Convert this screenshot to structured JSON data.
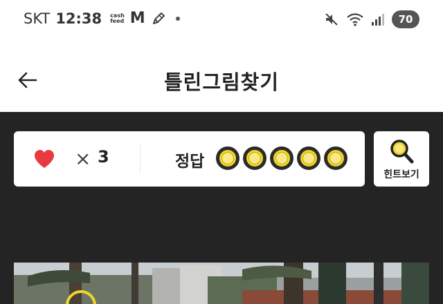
{
  "status_bar": {
    "carrier": "SKT",
    "time": "12:38",
    "cashfeed_top": "cash",
    "cashfeed_bottom": "feed",
    "m_icon": "M",
    "battery": "70",
    "icons": [
      "cashfeed-icon",
      "gmail-icon",
      "pen-icon",
      "notification-dot-icon",
      "mute-icon",
      "wifi-icon",
      "signal-icon",
      "battery-icon"
    ]
  },
  "header": {
    "title": "틀린그림찾기",
    "back_icon": "arrow-left-icon"
  },
  "game": {
    "lives_symbol": "×",
    "lives_count": "3",
    "answer_label": "정답",
    "answers_total": 5,
    "answers_found": 0,
    "hint_label": "힌트보기",
    "hint_icon": "magnifier-icon"
  },
  "colors": {
    "heart": "#e8393f",
    "accent_yellow": "#f1d62c",
    "dark_bg": "#242424"
  }
}
